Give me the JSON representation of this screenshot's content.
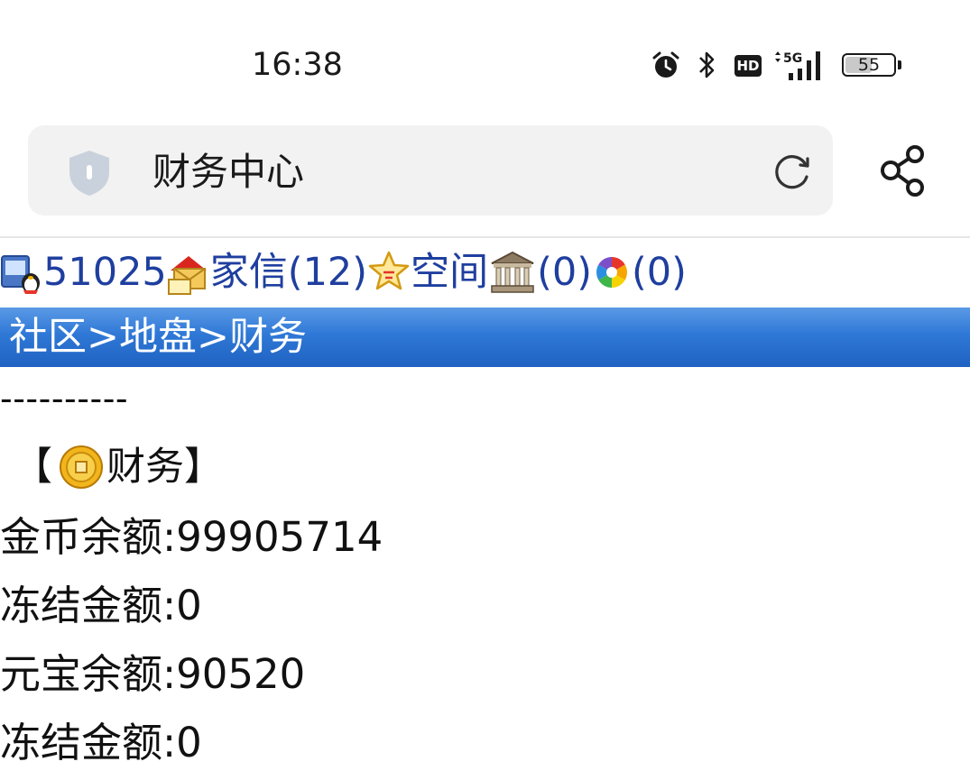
{
  "status": {
    "time": "16:38",
    "hd_label": "HD",
    "network_label": "5G",
    "battery": "55",
    "battery_level": 0.55
  },
  "browser": {
    "page_title": "财务中心",
    "icons": [
      "shield-icon",
      "reload-icon",
      "share-icon"
    ]
  },
  "nav": {
    "user_id": "51025",
    "mail_label": "家信(12)",
    "space_label": "空间",
    "bank_count": "(0)",
    "photo_count": "(0)"
  },
  "breadcrumb": {
    "home": "社区",
    "sep1": ">",
    "land": "地盘",
    "sep2": ">",
    "current": "财务"
  },
  "content": {
    "divider": "----------",
    "section_open": "【",
    "section_title": "财务",
    "section_close": "】",
    "gold_balance": "金币余额:99905714",
    "gold_frozen": "冻结金额:0",
    "yuanbao_balance": "元宝余额:90520",
    "yuanbao_frozen": "冻结金额:0"
  }
}
